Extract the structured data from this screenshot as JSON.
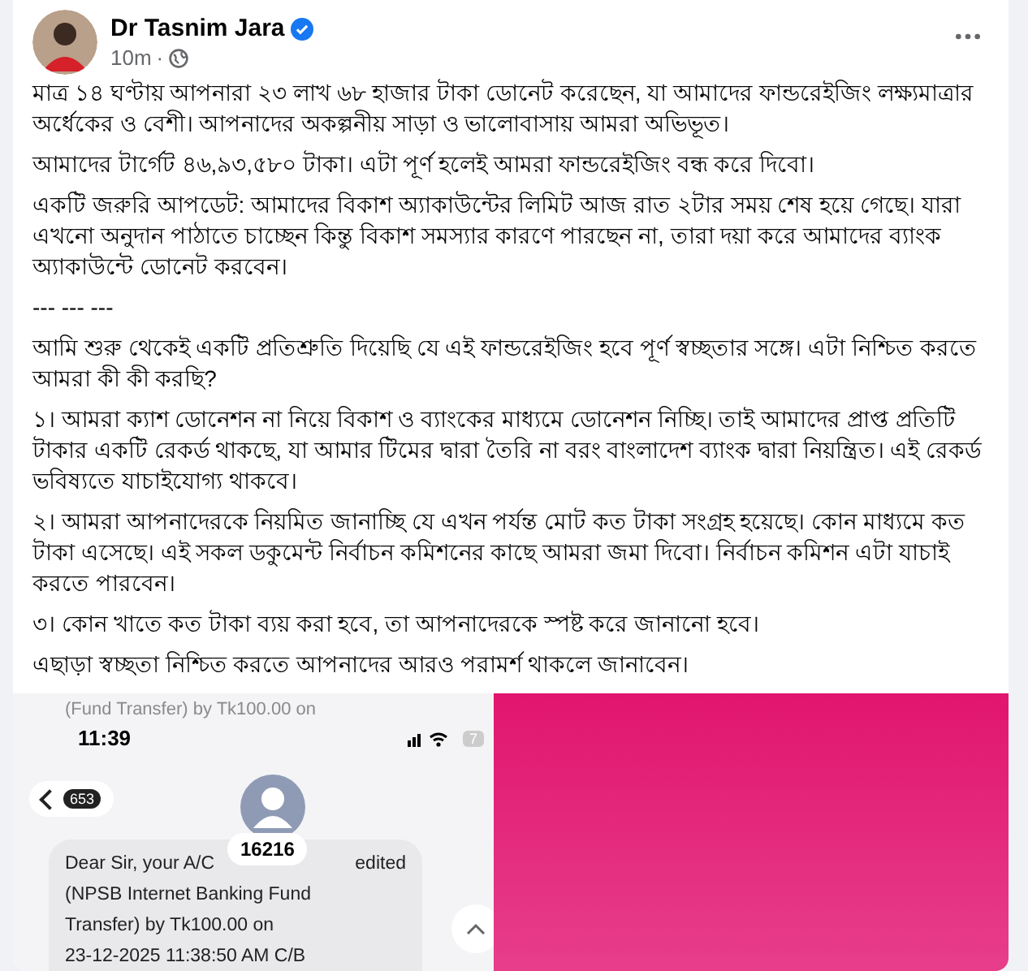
{
  "post": {
    "author": "Dr Tasnim Jara",
    "verified": true,
    "time": "10m",
    "separator": "·",
    "paragraphs": [
      "মাত্র ১৪ ঘণ্টায় আপনারা ২৩ লাখ ৬৮ হাজার টাকা ডোনেট করেছেন, যা আমাদের ফান্ডরেইজিং লক্ষ্যমাত্রার অর্ধেকের ও বেশী। আপনাদের অকল্পনীয় সাড়া ও ভালোবাসায় আমরা অভিভূত।",
      "আমাদের টার্গেট ৪৬,৯৩,৫৮০ টাকা। এটা পূর্ণ হলেই আমরা ফান্ডরেইজিং বন্ধ করে দিবো।",
      "একটি জরুরি আপডেট: আমাদের বিকাশ অ্যাকাউন্টের লিমিট আজ রাত ২টার সময় শেষ হয়ে গেছে। যারা এখনো অনুদান পাঠাতে চাচ্ছেন কিন্তু বিকাশ সমস্যার কারণে পারছেন না, তারা দয়া করে আমাদের ব্যাংক অ্যাকাউন্টে ডোনেট করবেন।",
      "--- --- ---",
      "আমি শুরু থেকেই একটি প্রতিশ্রুতি দিয়েছি যে এই ফান্ডরেইজিং হবে পূর্ণ স্বচ্ছতার সঙ্গে। এটা নিশ্চিত করতে আমরা কী কী করছি?",
      "১। আমরা ক্যাশ ডোনেশন না নিয়ে বিকাশ ও ব্যাংকের মাধ্যমে ডোনেশন নিচ্ছি। তাই আমাদের প্রাপ্ত প্রতিটি টাকার একটি রেকর্ড থাকছে, যা আমার টিমের দ্বারা তৈরি না বরং বাংলাদেশ ব্যাংক দ্বারা নিয়ন্ত্রিত। এই রেকর্ড ভবিষ্যতে যাচাইযোগ্য থাকবে।",
      "২। আমরা আপনাদেরকে নিয়মিত জানাচ্ছি যে এখন পর্যন্ত মোট কত টাকা সংগ্রহ হয়েছে। কোন মাধ্যমে কত টাকা এসেছে। এই সকল ডকুমেন্ট নির্বাচন কমিশনের কাছে আমরা জমা দিবো। নির্বাচন কমিশন এটা যাচাই করতে পারবেন।",
      "৩। কোন খাতে কত টাকা ব্যয় করা হবে, তা আপনাদেরকে স্পষ্ট করে জানানো হবে।",
      "এছাড়া স্বচ্ছতা নিশ্চিত করতে আপনাদের আরও পরামর্শ থাকলে জানাবেন।"
    ],
    "screenshot": {
      "time": "11:39",
      "battery": "7",
      "back_count": "653",
      "contact": "16216",
      "faded_message": "(Fund Transfer) by Tk100.00 on",
      "message_start": "Dear Sir, your A/C",
      "message_end": "edited",
      "message_lines": [
        "(NPSB Internet Banking Fund",
        "Transfer) by Tk100.00 on",
        "23-12-2025 11:38:50 AM C/B"
      ]
    }
  }
}
